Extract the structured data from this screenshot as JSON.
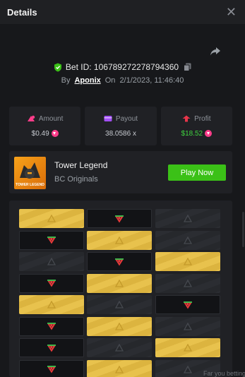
{
  "header": {
    "title": "Details",
    "close_icon": "close-icon"
  },
  "bet": {
    "id_text": "Bet ID: 106789272278794360",
    "by_label": "By",
    "user": "Aponix",
    "on_label": "On",
    "datetime": "2/1/2023, 11:46:40"
  },
  "stats": {
    "amount": {
      "label": "Amount",
      "value": "$0.49"
    },
    "payout": {
      "label": "Payout",
      "value": "38.0586 x"
    },
    "profit": {
      "label": "Profit",
      "value": "$18.52"
    }
  },
  "game": {
    "name": "Tower Legend",
    "provider": "BC Originals",
    "thumb_text": "TOWER LEGEND",
    "play_label": "Play Now"
  },
  "board": {
    "rows": [
      [
        "gold",
        "melon",
        "hidden"
      ],
      [
        "melon",
        "gold",
        "hidden"
      ],
      [
        "hidden",
        "melon",
        "gold"
      ],
      [
        "melon",
        "gold",
        "hidden"
      ],
      [
        "gold",
        "hidden",
        "melon"
      ],
      [
        "melon",
        "gold",
        "hidden"
      ],
      [
        "melon",
        "hidden",
        "gold"
      ],
      [
        "melon",
        "gold",
        "hidden"
      ]
    ]
  },
  "footer": {
    "partial_text": "Far you betting"
  },
  "colors": {
    "accent_green": "#3bc117",
    "profit_green": "#3fd33f",
    "gold": "#e8c24d",
    "coin_pink": "#ff3d8a"
  }
}
